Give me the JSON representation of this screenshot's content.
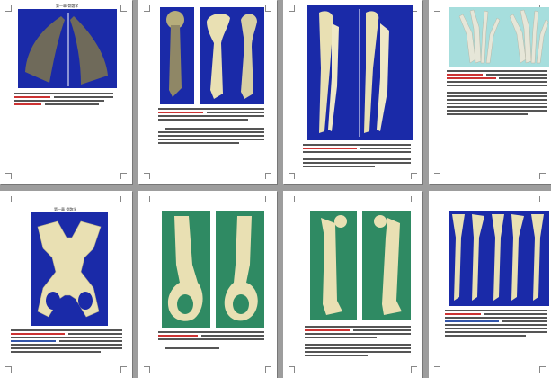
{
  "pages": [
    {
      "id": "page-1",
      "header": "第一章 骨骼学",
      "plates": [
        "scapula-lateral",
        "scapula-medial"
      ]
    },
    {
      "id": "page-2",
      "header": "",
      "plates": [
        "humerus-cranial",
        "humerus-lateral",
        "humerus-caudal"
      ]
    },
    {
      "id": "page-3",
      "header": "",
      "plates": [
        "radius-ulna-lateral",
        "radius-ulna-medial"
      ]
    },
    {
      "id": "page-4",
      "header": "",
      "plates": [
        "manus-dorsal",
        "manus-palmar"
      ]
    },
    {
      "id": "page-5",
      "header": "第一章 骨骼学",
      "plates": [
        "pelvis-dorsal"
      ]
    },
    {
      "id": "page-6",
      "header": "",
      "plates": [
        "os-coxae-lateral",
        "os-coxae-medial"
      ]
    },
    {
      "id": "page-7",
      "header": "",
      "plates": [
        "femur-cranial",
        "femur-caudal"
      ]
    },
    {
      "id": "page-8",
      "header": "",
      "plates": [
        "tibia-series"
      ]
    }
  ],
  "colors": {
    "blue_bg": "#1a2aa8",
    "teal_bg": "#a6dedd",
    "green_bg": "#2f8a63",
    "bone": "#e9e0b3",
    "dark_bone": "#6f6a5a",
    "canvas": "#9d9d9d"
  }
}
